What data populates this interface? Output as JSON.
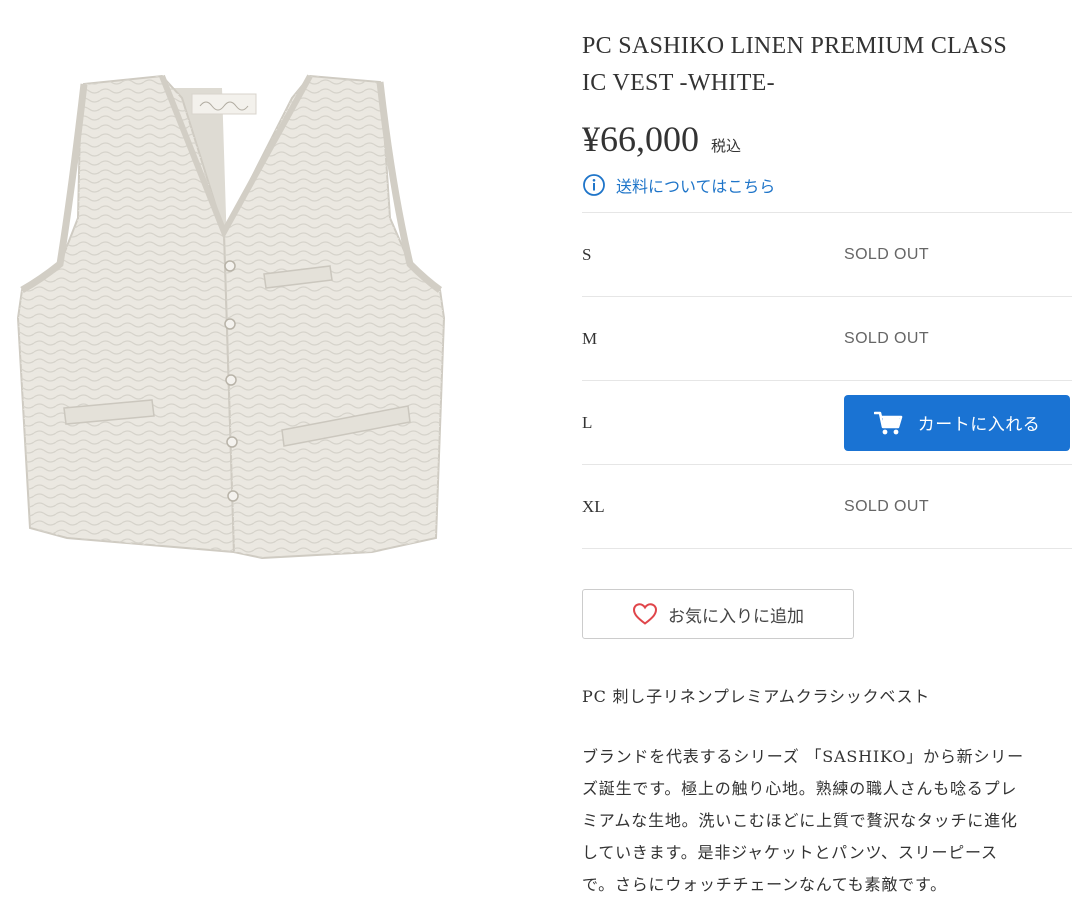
{
  "product": {
    "title_line1": "PC SASHIKO LINEN PREMIUM CLASS",
    "title_line2": "IC VEST -WHITE-",
    "image_alt": "PC SASHIKO LINEN PREMIUM CLASSIC VEST -WHITE-",
    "price": "¥66,000",
    "tax_label": "税込",
    "shipping_link": "送料についてはこちら",
    "variants": [
      {
        "size": "S",
        "status": "SOLD OUT"
      },
      {
        "size": "M",
        "status": "SOLD OUT"
      },
      {
        "size": "L",
        "action": "カートに入れる"
      },
      {
        "size": "XL",
        "status": "SOLD OUT"
      }
    ],
    "favorite_label": "お気に入りに追加",
    "subtitle": "PC 刺し子リネンプレミアムクラシックベスト",
    "description_lines": [
      "ブランドを代表するシリーズ 「SASHIKO」から新シリー",
      "ズ誕生です。極上の触り心地。熟練の職人さんも唸るプレ",
      "ミアムな生地。洗いこむほどに上質で贅沢なタッチに進化",
      "していきます。是非ジャケットとパンツ、スリーピース",
      "で。さらにウォッチチェーンなんても素敵です。"
    ]
  },
  "colors": {
    "accent_blue": "#1a73d3",
    "link_blue": "#1f75c9",
    "heart_red": "#e0454a"
  },
  "icons": {
    "info": "info-icon",
    "cart": "cart-icon",
    "heart": "heart-outline-icon"
  }
}
